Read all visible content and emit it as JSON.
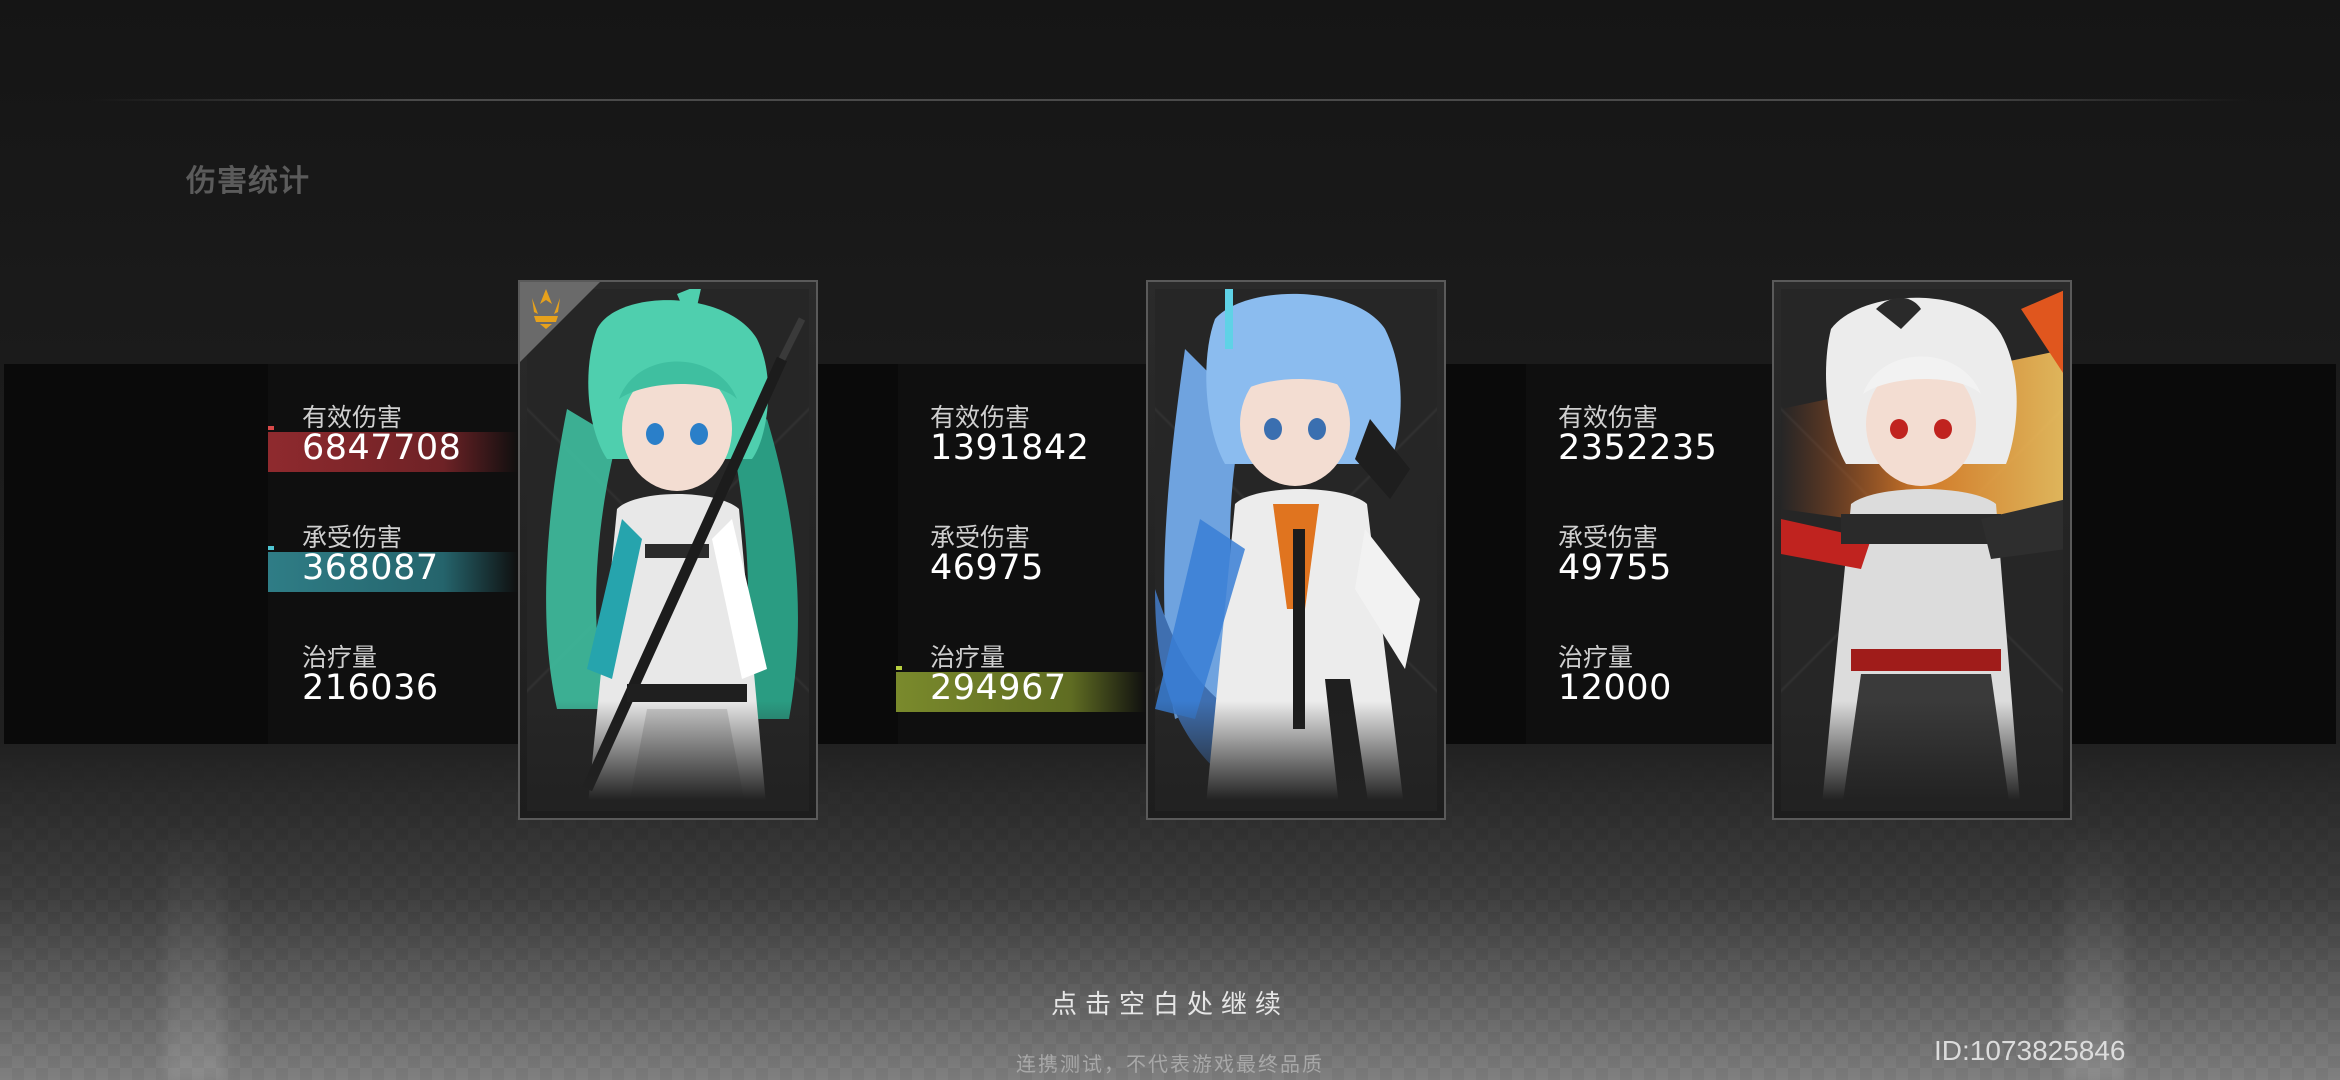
{
  "page": {
    "title": "伤害统计"
  },
  "labels": {
    "effective_damage": "有效伤害",
    "damage_taken": "承受伤害",
    "healing": "治疗量"
  },
  "colors": {
    "damage_bar": "#8f2a2e",
    "taken_bar": "#2f7d86",
    "heal_bar": "#7a8a2c",
    "mvp_icon": "#e6a11c"
  },
  "characters": [
    {
      "effective_damage": "6847708",
      "damage_taken": "368087",
      "healing": "216036",
      "highlight": [
        "effective_damage",
        "damage_taken"
      ],
      "mvp": true,
      "portrait": {
        "hair": "#3fbfa0",
        "hair_dark": "#1f7f6a",
        "outfit": "#e6e6e6",
        "accent": "#1f1f1f"
      }
    },
    {
      "effective_damage": "1391842",
      "damage_taken": "46975",
      "healing": "294967",
      "highlight": [
        "healing"
      ],
      "mvp": false,
      "portrait": {
        "hair": "#7fb0e6",
        "hair_dark": "#3f6fb0",
        "outfit": "#ececec",
        "accent": "#e0741f"
      }
    },
    {
      "effective_damage": "2352235",
      "damage_taken": "49755",
      "healing": "12000",
      "highlight": [],
      "mvp": false,
      "portrait": {
        "hair": "#e8e8e8",
        "hair_dark": "#a8a8a8",
        "outfit": "#dcdcdc",
        "accent": "#c0231f"
      }
    }
  ],
  "footer": {
    "continue_text": "点击空白处继续",
    "disclaimer": "连携测试，不代表游戏最终品质",
    "player_id": "ID:1073825846"
  }
}
